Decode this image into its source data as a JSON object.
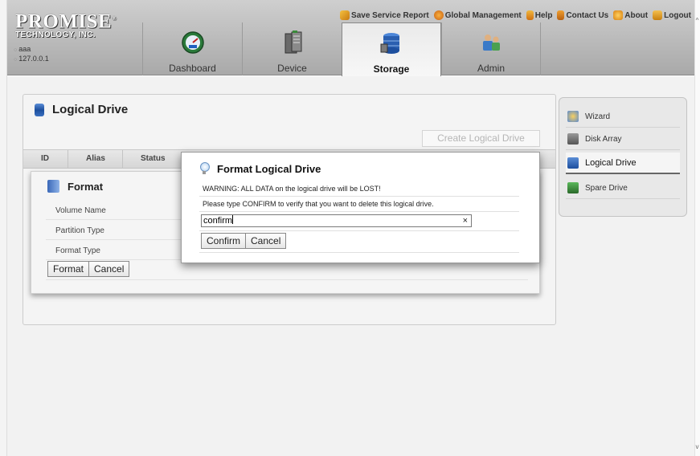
{
  "header": {
    "logo_line1": "PROMISE",
    "logo_reg": "®",
    "logo_line2": "TECHNOLOGY, INC.",
    "user": "aaa",
    "host": "127.0.0.1",
    "top_links": [
      {
        "label": "Save Service Report",
        "icon": "report-icon",
        "color": "#e0a020"
      },
      {
        "label": "Global Management",
        "icon": "globe-icon",
        "color": "#e07a10"
      },
      {
        "label": "Help",
        "icon": "help-icon",
        "color": "#e0a020"
      },
      {
        "label": "Contact Us",
        "icon": "phone-icon",
        "color": "#d87a10"
      },
      {
        "label": "About",
        "icon": "about-icon",
        "color": "#e08a10"
      },
      {
        "label": "Logout",
        "icon": "logout-icon",
        "color": "#d89010"
      }
    ],
    "tabs": [
      {
        "label": "Dashboard",
        "icon": "gauge-icon"
      },
      {
        "label": "Device",
        "icon": "server-icon"
      },
      {
        "label": "Storage",
        "icon": "database-icon",
        "active": true
      },
      {
        "label": "Admin",
        "icon": "users-icon"
      }
    ]
  },
  "main": {
    "title": "Logical Drive",
    "create_button": "Create Logical Drive",
    "columns": [
      "ID",
      "Alias",
      "Status"
    ],
    "format_form": {
      "title": "Format",
      "fields": [
        "Volume Name",
        "Partition Type",
        "Format Type"
      ],
      "format_button": "Format",
      "cancel_button": "Cancel"
    }
  },
  "right_menu": {
    "items": [
      {
        "label": "Wizard",
        "icon": "wizard-icon"
      },
      {
        "label": "Disk Array",
        "icon": "disk-array-icon"
      },
      {
        "label": "Logical Drive",
        "icon": "logical-drive-icon",
        "active": true
      },
      {
        "label": "Spare Drive",
        "icon": "spare-drive-icon"
      }
    ]
  },
  "dialog": {
    "title": "Format Logical Drive",
    "warning": "WARNING: ALL DATA on the logical drive will be LOST!",
    "instruction": "Please type CONFIRM to verify that you want to delete this logical drive.",
    "input_value": "confirm",
    "clear_glyph": "×",
    "confirm_button": "Confirm",
    "cancel_button": "Cancel"
  },
  "colors": {
    "accent_blue": "#1d4f9e",
    "header_gray": "#b8b8b8",
    "disabled_text": "#b5b5b5"
  }
}
